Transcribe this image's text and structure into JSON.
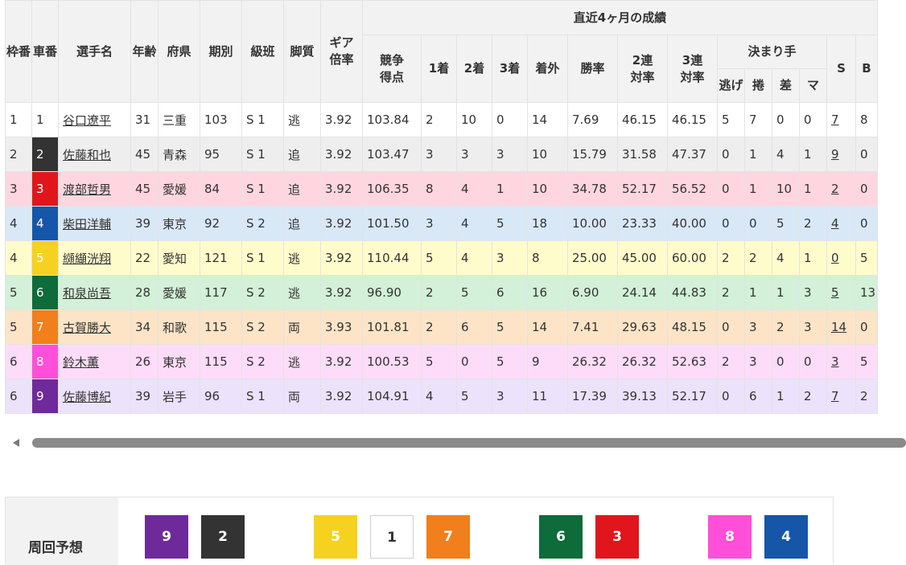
{
  "headers": {
    "waku": "枠番",
    "sha": "車番",
    "name": "選手名",
    "age": "年齢",
    "pref": "府県",
    "term": "期別",
    "rank": "級班",
    "style": "脚質",
    "gear": "ギア倍率",
    "score": "競争得点",
    "recent": "直近4ヶ月の成績",
    "first": "1着",
    "second": "2着",
    "third": "3着",
    "out": "着外",
    "win_rate": "勝率",
    "rate2": "2連対率",
    "rate3": "3連対率",
    "kimarite": "決まり手",
    "nige": "逃げ",
    "makuri": "捲",
    "sashi": "差",
    "ma": "マ",
    "s": "S",
    "b": "B"
  },
  "rows": [
    {
      "waku": "1",
      "car": "1",
      "car_bg": "#ffffff",
      "car_fg": "#333333",
      "row_bg": "#ffffff",
      "name": "谷口遼平",
      "age": "31",
      "pref": "三重",
      "term": "103",
      "rank": "S 1",
      "style": "逃",
      "gear": "3.92",
      "score": "103.84",
      "first": "2",
      "second": "10",
      "third": "0",
      "out": "14",
      "win": "7.69",
      "r2": "46.15",
      "r3": "46.15",
      "nige": "5",
      "makuri": "7",
      "sashi": "0",
      "ma": "0",
      "s": "7",
      "b": "8"
    },
    {
      "waku": "2",
      "car": "2",
      "car_bg": "#333333",
      "car_fg": "#ffffff",
      "row_bg": "#eeeeee",
      "name": "佐藤和也",
      "age": "45",
      "pref": "青森",
      "term": "95",
      "rank": "S 1",
      "style": "追",
      "gear": "3.92",
      "score": "103.47",
      "first": "3",
      "second": "3",
      "third": "3",
      "out": "10",
      "win": "15.79",
      "r2": "31.58",
      "r3": "47.37",
      "nige": "0",
      "makuri": "1",
      "sashi": "4",
      "ma": "1",
      "s": "9",
      "b": "0"
    },
    {
      "waku": "3",
      "car": "3",
      "car_bg": "#e0161c",
      "car_fg": "#ffffff",
      "row_bg": "#ffd6df",
      "name": "渡部哲男",
      "age": "45",
      "pref": "愛媛",
      "term": "84",
      "rank": "S 1",
      "style": "追",
      "gear": "3.92",
      "score": "106.35",
      "first": "8",
      "second": "4",
      "third": "1",
      "out": "10",
      "win": "34.78",
      "r2": "52.17",
      "r3": "56.52",
      "nige": "0",
      "makuri": "1",
      "sashi": "10",
      "ma": "1",
      "s": "2",
      "b": "0"
    },
    {
      "waku": "4",
      "car": "4",
      "car_bg": "#1556a8",
      "car_fg": "#ffffff",
      "row_bg": "#d9e8f7",
      "name": "柴田洋輔",
      "age": "39",
      "pref": "東京",
      "term": "92",
      "rank": "S 2",
      "style": "追",
      "gear": "3.92",
      "score": "101.50",
      "first": "3",
      "second": "4",
      "third": "5",
      "out": "18",
      "win": "10.00",
      "r2": "23.33",
      "r3": "40.00",
      "nige": "0",
      "makuri": "0",
      "sashi": "5",
      "ma": "2",
      "s": "4",
      "b": "0"
    },
    {
      "waku": "4",
      "car": "5",
      "car_bg": "#f5d21f",
      "car_fg": "#ffffff",
      "row_bg": "#fffccc",
      "name": "纐纈洸翔",
      "age": "22",
      "pref": "愛知",
      "term": "121",
      "rank": "S 1",
      "style": "逃",
      "gear": "3.92",
      "score": "110.44",
      "first": "5",
      "second": "4",
      "third": "3",
      "out": "8",
      "win": "25.00",
      "r2": "45.00",
      "r3": "60.00",
      "nige": "2",
      "makuri": "2",
      "sashi": "4",
      "ma": "1",
      "s": "0",
      "b": "5"
    },
    {
      "waku": "5",
      "car": "6",
      "car_bg": "#0e6b3a",
      "car_fg": "#ffffff",
      "row_bg": "#d3f0d8",
      "name": "和泉尚吾",
      "age": "28",
      "pref": "愛媛",
      "term": "117",
      "rank": "S 2",
      "style": "逃",
      "gear": "3.92",
      "score": "96.90",
      "first": "2",
      "second": "5",
      "third": "6",
      "out": "16",
      "win": "6.90",
      "r2": "24.14",
      "r3": "44.83",
      "nige": "2",
      "makuri": "1",
      "sashi": "1",
      "ma": "3",
      "s": "5",
      "b": "13"
    },
    {
      "waku": "5",
      "car": "7",
      "car_bg": "#f07f1c",
      "car_fg": "#ffffff",
      "row_bg": "#fde4c6",
      "name": "古賀勝大",
      "age": "34",
      "pref": "和歌",
      "term": "115",
      "rank": "S 2",
      "style": "両",
      "gear": "3.93",
      "score": "101.81",
      "first": "2",
      "second": "6",
      "third": "5",
      "out": "14",
      "win": "7.41",
      "r2": "29.63",
      "r3": "48.15",
      "nige": "0",
      "makuri": "3",
      "sashi": "2",
      "ma": "3",
      "s": "14",
      "b": "0"
    },
    {
      "waku": "6",
      "car": "8",
      "car_bg": "#ff4fd8",
      "car_fg": "#ffffff",
      "row_bg": "#fddcf9",
      "name": "鈴木薫",
      "age": "26",
      "pref": "東京",
      "term": "115",
      "rank": "S 2",
      "style": "逃",
      "gear": "3.92",
      "score": "100.53",
      "first": "5",
      "second": "0",
      "third": "5",
      "out": "9",
      "win": "26.32",
      "r2": "26.32",
      "r3": "52.63",
      "nige": "2",
      "makuri": "3",
      "sashi": "0",
      "ma": "0",
      "s": "3",
      "b": "5"
    },
    {
      "waku": "6",
      "car": "9",
      "car_bg": "#6e2a9a",
      "car_fg": "#ffffff",
      "row_bg": "#ece2fb",
      "name": "佐藤博紀",
      "age": "39",
      "pref": "岩手",
      "term": "96",
      "rank": "S 1",
      "style": "両",
      "gear": "3.92",
      "score": "104.91",
      "first": "4",
      "second": "5",
      "third": "3",
      "out": "11",
      "win": "17.39",
      "r2": "39.13",
      "r3": "52.17",
      "nige": "0",
      "makuri": "6",
      "sashi": "1",
      "ma": "2",
      "s": "7",
      "b": "2"
    }
  ],
  "forecast": {
    "label": "周回予想",
    "chips": [
      {
        "num": "9",
        "bg": "#6e2a9a",
        "fg": "#ffffff"
      },
      {
        "num": "2",
        "bg": "#333333",
        "fg": "#ffffff"
      },
      {
        "num": "5",
        "bg": "#f5d21f",
        "fg": "#ffffff"
      },
      {
        "num": "1",
        "bg": "#ffffff",
        "fg": "#333333"
      },
      {
        "num": "7",
        "bg": "#f07f1c",
        "fg": "#ffffff"
      },
      {
        "num": "6",
        "bg": "#0e6b3a",
        "fg": "#ffffff"
      },
      {
        "num": "3",
        "bg": "#e0161c",
        "fg": "#ffffff"
      },
      {
        "num": "8",
        "bg": "#ff4fd8",
        "fg": "#ffffff"
      },
      {
        "num": "4",
        "bg": "#1556a8",
        "fg": "#ffffff"
      }
    ]
  }
}
